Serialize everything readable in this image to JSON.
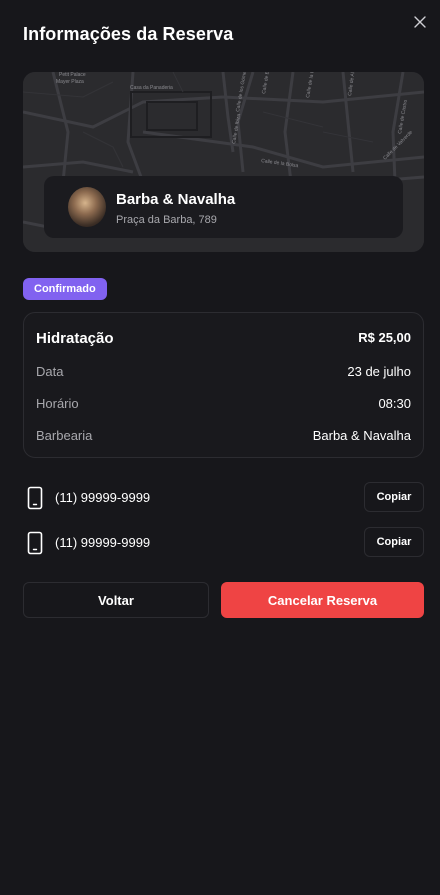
{
  "header": {
    "title": "Informações da Reserva",
    "close_icon": "close-icon"
  },
  "map": {
    "street_labels": [
      "Petit Palace",
      "Mayer Plaza",
      "Casa da Panaderia",
      "Calle de los Gómez",
      "Calle de Ibiza",
      "Calle de Espe",
      "Calle de la Reina",
      "Calle de Alcalá",
      "Calle de Castro",
      "Calle de Valverde",
      "Calle de la Bolsa"
    ]
  },
  "shop": {
    "name": "Barba & Navalha",
    "address": "Praça da Barba, 789"
  },
  "status": {
    "label": "Confirmado",
    "color": "#8162f0"
  },
  "booking": {
    "service": "Hidratação",
    "price": "R$ 25,00",
    "rows": [
      {
        "label": "Data",
        "value": "23 de julho"
      },
      {
        "label": "Horário",
        "value": "08:30"
      },
      {
        "label": "Barbearia",
        "value": "Barba & Navalha"
      }
    ]
  },
  "phones": [
    {
      "number": "(11) 99999-9999",
      "copy_label": "Copiar",
      "icon": "smartphone-icon"
    },
    {
      "number": "(11) 99999-9999",
      "copy_label": "Copiar",
      "icon": "smartphone-icon"
    }
  ],
  "actions": {
    "back_label": "Voltar",
    "cancel_label": "Cancelar Reserva",
    "cancel_color": "#ef4444"
  }
}
